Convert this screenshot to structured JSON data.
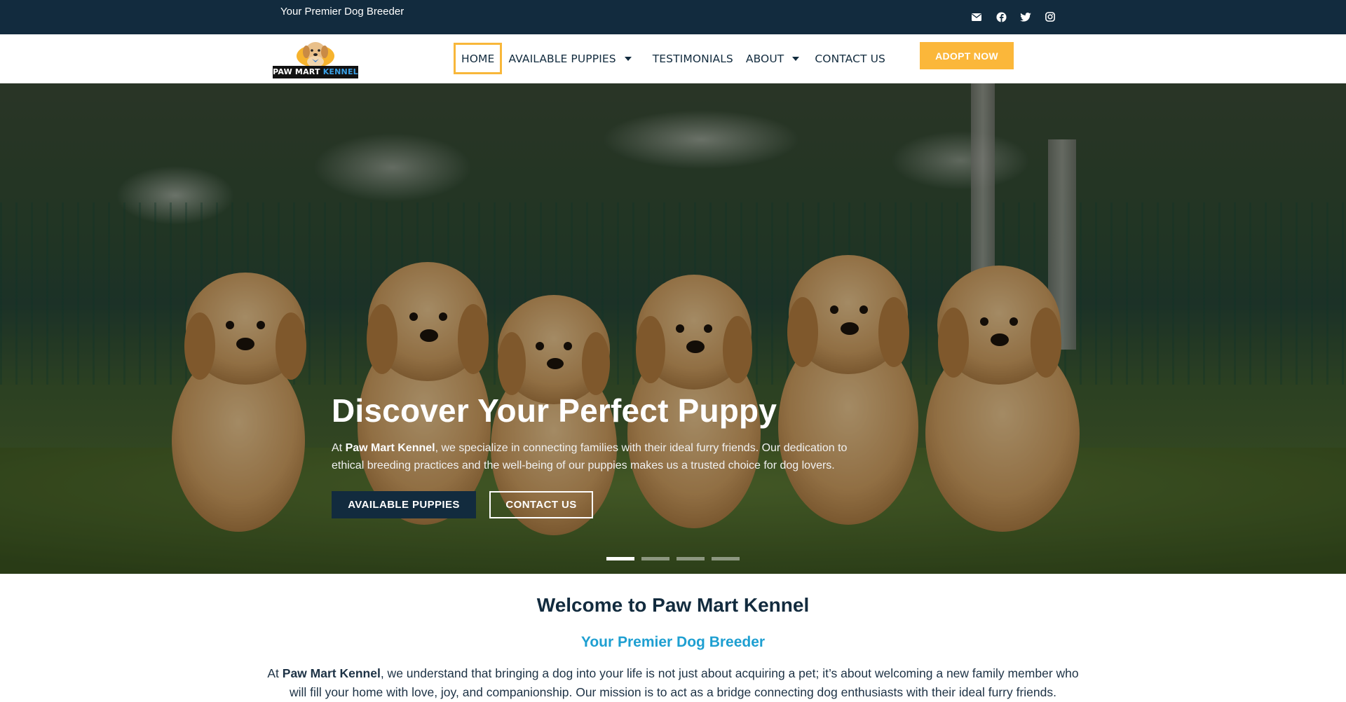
{
  "topbar": {
    "tagline": "Your Premier Dog Breeder",
    "social_icons": [
      "envelope-icon",
      "facebook-icon",
      "twitter-icon",
      "instagram-icon"
    ]
  },
  "header": {
    "logo": {
      "line1": "PAW MART",
      "line2": "KENNEL"
    },
    "nav": {
      "home": "HOME",
      "available_puppies": "AVAILABLE PUPPIES",
      "testimonials": "TESTIMONIALS",
      "about": "ABOUT",
      "contact": "CONTACT US"
    },
    "adopt_button": "ADOPT NOW"
  },
  "hero": {
    "title": "Discover Your Perfect Puppy",
    "text_prefix": "At ",
    "text_brand": "Paw Mart Kennel",
    "text_suffix": ", we specialize in connecting families with their ideal furry friends. Our dedication to ethical breeding practices and the well-being of our puppies makes us a trusted choice for dog lovers.",
    "primary_button": "AVAILABLE PUPPIES",
    "secondary_button": "CONTACT US",
    "slides": 4,
    "active_slide": 1
  },
  "welcome": {
    "title": "Welcome to Paw Mart Kennel",
    "subtitle": "Your Premier Dog Breeder",
    "text_prefix": "At ",
    "text_brand": "Paw Mart Kennel",
    "text_suffix": ", we understand that bringing a dog into your life is not just about acquiring a pet; it’s about welcoming a new family member who will fill your home with love, joy, and companionship. Our mission is to act as a bridge connecting dog enthusiasts with their ideal furry friends."
  },
  "colors": {
    "navy": "#122b3e",
    "accent_yellow": "#fbb73a",
    "subtitle_blue": "#1e9fd1"
  }
}
